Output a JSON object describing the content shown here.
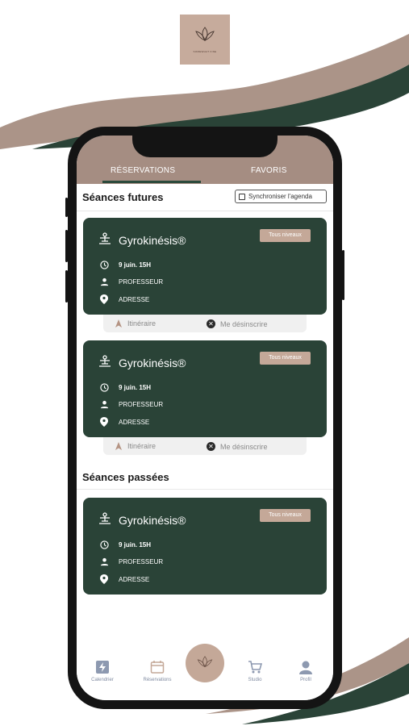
{
  "brand": {
    "logo_text": "SOMEWHAT FINE",
    "colors": {
      "brand_green": "#2a4337",
      "brand_taupe": "#a58d82",
      "badge": "#c4a898"
    }
  },
  "tabs": [
    {
      "label": "RÉSERVATIONS",
      "active": true
    },
    {
      "label": "FAVORIS",
      "active": false
    }
  ],
  "future": {
    "title": "Séances futures",
    "sync_label": "Synchroniser l'agenda",
    "sessions": [
      {
        "title": "Gyrokinésis®",
        "badge": "Tous niveaux",
        "date": "9 juin. 15H",
        "teacher": "PROFESSEUR",
        "address": "ADRESSE",
        "route_label": "Itinéraire",
        "unsubscribe_label": "Me désinscrire"
      },
      {
        "title": "Gyrokinésis®",
        "badge": "Tous niveaux",
        "date": "9 juin. 15H",
        "teacher": "PROFESSEUR",
        "address": "ADRESSE",
        "route_label": "Itinéraire",
        "unsubscribe_label": "Me désinscrire"
      }
    ]
  },
  "past": {
    "title": "Séances passées",
    "sessions": [
      {
        "title": "Gyrokinésis®",
        "badge": "Tous niveaux",
        "date": "9 juin. 15H",
        "teacher": "PROFESSEUR",
        "address": "ADRESSE"
      }
    ]
  },
  "nav": {
    "items": [
      {
        "label": "Calendrier",
        "icon": "bolt-icon"
      },
      {
        "label": "Réservations",
        "icon": "calendar-icon"
      },
      {
        "label": "Studio",
        "icon": "cart-icon"
      },
      {
        "label": "Profil",
        "icon": "user-icon"
      }
    ],
    "center_icon": "lotus-icon"
  }
}
